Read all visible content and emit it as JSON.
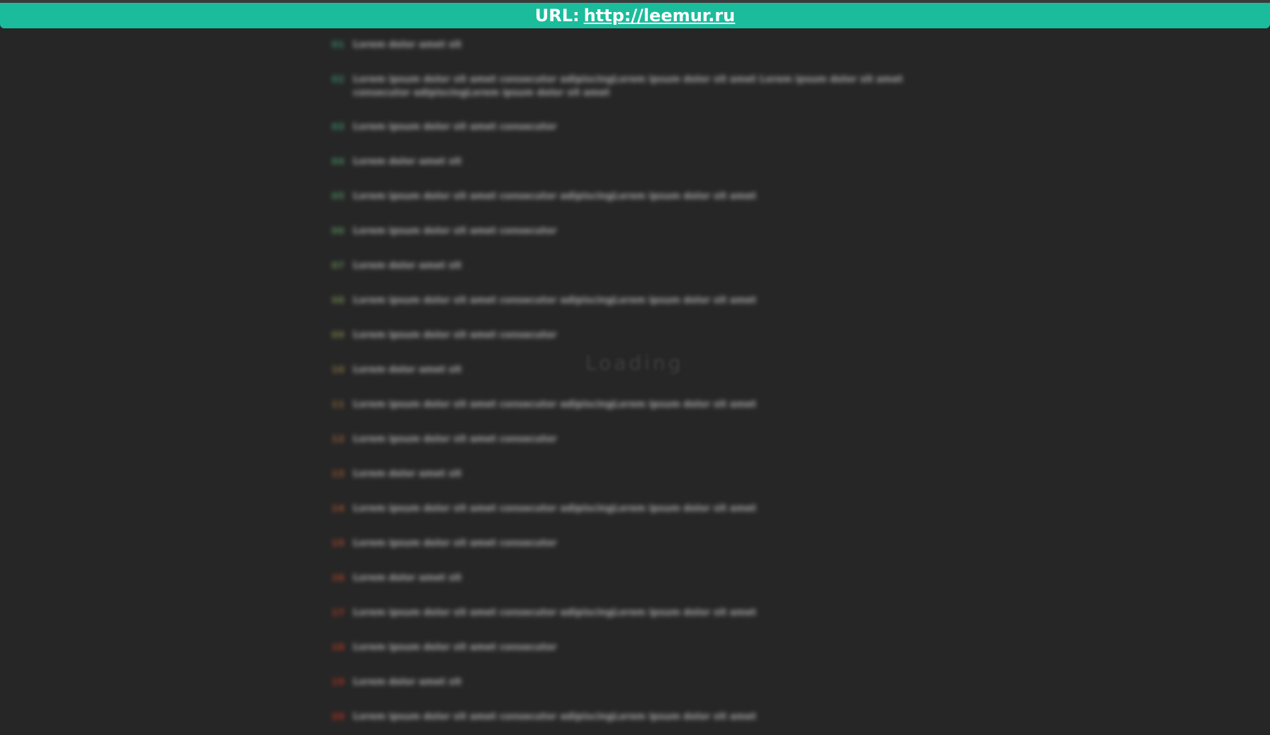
{
  "url_bar": {
    "prefix": "URL:",
    "link": "http://leemur.ru",
    "color": "#1abc9c"
  },
  "loading_text": "Loading",
  "list": [
    {
      "num": "01",
      "color": "#3fa37a",
      "text": "Lorem dolor amet sit"
    },
    {
      "num": "02",
      "color": "#41a479",
      "text": "Lorem ipsum dolor sit amet consecutor adipiscingLorem ipsum dolor sit amet Lorem ipsum dolor sit amet consecutor adipiscingLorem ipsum dolor sit amet"
    },
    {
      "num": "03",
      "color": "#46a676",
      "text": "Lorem ipsum dolor sit amet consecutor"
    },
    {
      "num": "04",
      "color": "#4ea673",
      "text": "Lorem dolor amet sit"
    },
    {
      "num": "05",
      "color": "#58a56f",
      "text": "Lorem ipsum dolor sit amet consecutor adipiscingLorem ipsum dolor sit amet"
    },
    {
      "num": "06",
      "color": "#64a36a",
      "text": "Lorem ipsum dolor sit amet consecutor"
    },
    {
      "num": "07",
      "color": "#72a064",
      "text": "Lorem dolor amet sit"
    },
    {
      "num": "08",
      "color": "#829a5c",
      "text": "Lorem ipsum dolor sit amet consecutor adipiscingLorem ipsum dolor sit amet"
    },
    {
      "num": "09",
      "color": "#929254",
      "text": "Lorem ipsum dolor sit amet consecutor"
    },
    {
      "num": "10",
      "color": "#a0884c",
      "text": "Lorem dolor amet sit"
    },
    {
      "num": "11",
      "color": "#ac7d45",
      "text": "Lorem ipsum dolor sit amet consecutor adipiscingLorem ipsum dolor sit amet"
    },
    {
      "num": "12",
      "color": "#b6723f",
      "text": "Lorem ipsum dolor sit amet consecutor"
    },
    {
      "num": "13",
      "color": "#be6739",
      "text": "Lorem dolor amet sit"
    },
    {
      "num": "14",
      "color": "#c45d34",
      "text": "Lorem ipsum dolor sit amet consecutor adipiscingLorem ipsum dolor sit amet"
    },
    {
      "num": "15",
      "color": "#c8542f",
      "text": "Lorem ipsum dolor sit amet consecutor"
    },
    {
      "num": "16",
      "color": "#cc4c2b",
      "text": "Lorem dolor amet sit"
    },
    {
      "num": "17",
      "color": "#cf4528",
      "text": "Lorem ipsum dolor sit amet consecutor adipiscingLorem ipsum dolor sit amet"
    },
    {
      "num": "18",
      "color": "#d13f25",
      "text": "Lorem ipsum dolor sit amet consecutor"
    },
    {
      "num": "19",
      "color": "#d33a23",
      "text": "Lorem dolor amet sit"
    },
    {
      "num": "20",
      "color": "#d53621",
      "text": "Lorem ipsum dolor sit amet consecutor adipiscingLorem ipsum dolor sit amet"
    }
  ]
}
